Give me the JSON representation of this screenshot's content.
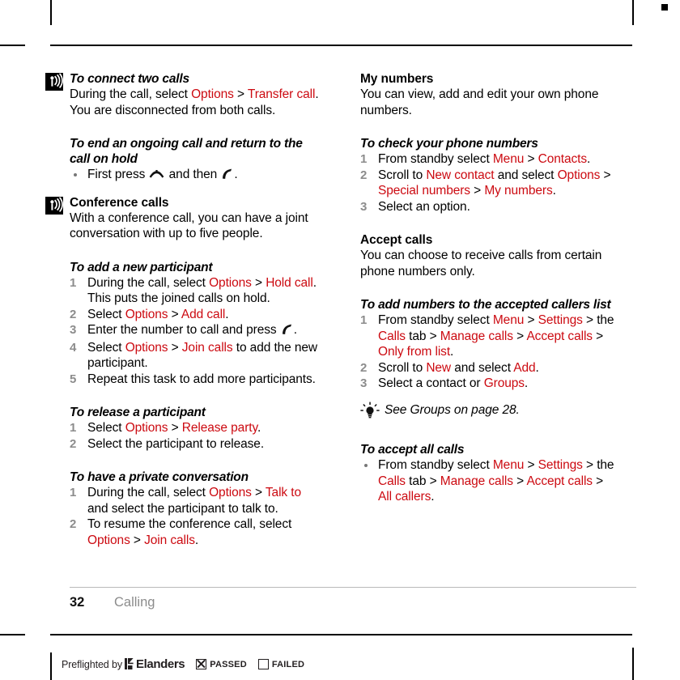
{
  "page": {
    "number": "32",
    "chapter": "Calling",
    "accent_color": "#cc0a11",
    "step_number_color": "#8c8c8c"
  },
  "left_column": {
    "blocks": [
      {
        "icon": "note-antenna-icon",
        "heading": "To connect two calls",
        "body_runs": [
          {
            "t": "During the call, select ",
            "k": false
          },
          {
            "t": "Options",
            "k": true
          },
          {
            "t": " > ",
            "k": false
          },
          {
            "t": "Transfer call",
            "k": true
          },
          {
            "t": ". You are disconnected from both calls.",
            "k": false
          }
        ]
      }
    ],
    "end_ongoing": {
      "heading": "To end an ongoing call and return to the call on hold",
      "bullet_runs": [
        {
          "t": "First press ",
          "k": false
        },
        {
          "t": "end-call-key-icon",
          "icon": true
        },
        {
          "t": " and then ",
          "k": false
        },
        {
          "t": "call-key-icon",
          "icon": true
        },
        {
          "t": ".",
          "k": false
        }
      ]
    },
    "conference": {
      "icon": "note-antenna-icon",
      "heading": "Conference calls",
      "body": "With a conference call, you can have a joint conversation with up to five people."
    },
    "add_participant": {
      "heading": "To add a new participant",
      "steps": [
        {
          "n": "1",
          "runs": [
            {
              "t": "During the call, select ",
              "k": false
            },
            {
              "t": "Options",
              "k": true
            },
            {
              "t": " > ",
              "k": false
            },
            {
              "t": "Hold call",
              "k": true
            },
            {
              "t": ". This puts the joined calls on hold.",
              "k": false
            }
          ]
        },
        {
          "n": "2",
          "runs": [
            {
              "t": "Select ",
              "k": false
            },
            {
              "t": "Options",
              "k": true
            },
            {
              "t": " > ",
              "k": false
            },
            {
              "t": "Add call",
              "k": true
            },
            {
              "t": ".",
              "k": false
            }
          ]
        },
        {
          "n": "3",
          "runs": [
            {
              "t": "Enter the number to call and press ",
              "k": false
            },
            {
              "t": "call-key-icon",
              "icon": true
            },
            {
              "t": ".",
              "k": false
            }
          ]
        },
        {
          "n": "4",
          "runs": [
            {
              "t": "Select ",
              "k": false
            },
            {
              "t": "Options",
              "k": true
            },
            {
              "t": " > ",
              "k": false
            },
            {
              "t": "Join calls",
              "k": true
            },
            {
              "t": " to add the new participant.",
              "k": false
            }
          ]
        },
        {
          "n": "5",
          "runs": [
            {
              "t": "Repeat this task to add more participants.",
              "k": false
            }
          ]
        }
      ]
    },
    "release_participant": {
      "heading": "To release a participant",
      "steps": [
        {
          "n": "1",
          "runs": [
            {
              "t": "Select ",
              "k": false
            },
            {
              "t": "Options",
              "k": true
            },
            {
              "t": " > ",
              "k": false
            },
            {
              "t": "Release party",
              "k": true
            },
            {
              "t": ".",
              "k": false
            }
          ]
        },
        {
          "n": "2",
          "runs": [
            {
              "t": "Select the participant to release.",
              "k": false
            }
          ]
        }
      ]
    },
    "private_conversation": {
      "heading": "To have a private conversation",
      "steps": [
        {
          "n": "1",
          "runs": [
            {
              "t": "During the call, select ",
              "k": false
            },
            {
              "t": "Options",
              "k": true
            },
            {
              "t": " > ",
              "k": false
            },
            {
              "t": "Talk to",
              "k": true
            },
            {
              "t": " and select the participant to talk to.",
              "k": false
            }
          ]
        },
        {
          "n": "2",
          "runs": [
            {
              "t": "To resume the conference call, select ",
              "k": false
            },
            {
              "t": "Options",
              "k": true
            },
            {
              "t": " > ",
              "k": false
            },
            {
              "t": "Join calls",
              "k": true
            },
            {
              "t": ".",
              "k": false
            }
          ]
        }
      ]
    }
  },
  "right_column": {
    "my_numbers": {
      "heading": "My numbers",
      "body": "You can view, add and edit your own phone numbers."
    },
    "check_numbers": {
      "heading": "To check your phone numbers",
      "steps": [
        {
          "n": "1",
          "runs": [
            {
              "t": "From standby select ",
              "k": false
            },
            {
              "t": "Menu",
              "k": true
            },
            {
              "t": " > ",
              "k": false
            },
            {
              "t": "Contacts",
              "k": true
            },
            {
              "t": ".",
              "k": false
            }
          ]
        },
        {
          "n": "2",
          "runs": [
            {
              "t": "Scroll to ",
              "k": false
            },
            {
              "t": "New contact",
              "k": true
            },
            {
              "t": " and select ",
              "k": false
            },
            {
              "t": "Options",
              "k": true
            },
            {
              "t": " > ",
              "k": false
            },
            {
              "t": "Special numbers",
              "k": true
            },
            {
              "t": " > ",
              "k": false
            },
            {
              "t": "My numbers",
              "k": true
            },
            {
              "t": ".",
              "k": false
            }
          ]
        },
        {
          "n": "3",
          "runs": [
            {
              "t": "Select an option.",
              "k": false
            }
          ]
        }
      ]
    },
    "accept_calls": {
      "heading": "Accept calls",
      "body": "You can choose to receive calls from certain phone numbers only."
    },
    "add_accepted": {
      "heading": "To add numbers to the accepted callers list",
      "steps": [
        {
          "n": "1",
          "runs": [
            {
              "t": "From standby select ",
              "k": false
            },
            {
              "t": "Menu",
              "k": true
            },
            {
              "t": " > ",
              "k": false
            },
            {
              "t": "Settings",
              "k": true
            },
            {
              "t": " > the ",
              "k": false
            },
            {
              "t": "Calls",
              "k": true
            },
            {
              "t": " tab > ",
              "k": false
            },
            {
              "t": "Manage calls",
              "k": true
            },
            {
              "t": " > ",
              "k": false
            },
            {
              "t": "Accept calls",
              "k": true
            },
            {
              "t": " > ",
              "k": false
            },
            {
              "t": "Only from list",
              "k": true
            },
            {
              "t": ".",
              "k": false
            }
          ]
        },
        {
          "n": "2",
          "runs": [
            {
              "t": "Scroll to ",
              "k": false
            },
            {
              "t": "New",
              "k": true
            },
            {
              "t": " and select ",
              "k": false
            },
            {
              "t": "Add",
              "k": true
            },
            {
              "t": ".",
              "k": false
            }
          ]
        },
        {
          "n": "3",
          "runs": [
            {
              "t": "Select a contact or ",
              "k": false
            },
            {
              "t": "Groups",
              "k": true
            },
            {
              "t": ".",
              "k": false
            }
          ]
        }
      ]
    },
    "tip": {
      "icon": "light-bulb-icon",
      "text": "See Groups on page 28."
    },
    "accept_all": {
      "heading": "To accept all calls",
      "bullet_runs": [
        {
          "t": "From standby select ",
          "k": false
        },
        {
          "t": "Menu",
          "k": true
        },
        {
          "t": " > ",
          "k": false
        },
        {
          "t": "Settings",
          "k": true
        },
        {
          "t": " > the ",
          "k": false
        },
        {
          "t": "Calls",
          "k": true
        },
        {
          "t": " tab > ",
          "k": false
        },
        {
          "t": "Manage calls",
          "k": true
        },
        {
          "t": " > ",
          "k": false
        },
        {
          "t": "Accept calls",
          "k": true
        },
        {
          "t": " > ",
          "k": false
        },
        {
          "t": "All callers",
          "k": true
        },
        {
          "t": ".",
          "k": false
        }
      ]
    }
  },
  "preflight": {
    "text": "Preflighted by",
    "brand": "Elanders",
    "passed_label": "PASSED",
    "failed_label": "FAILED",
    "passed_checked": true,
    "failed_checked": false
  }
}
